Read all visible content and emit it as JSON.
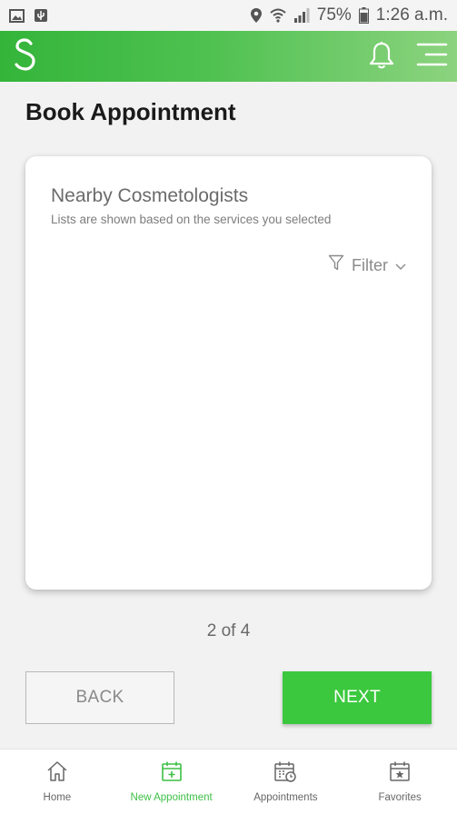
{
  "status_bar": {
    "battery": "75%",
    "time": "1:26 a.m."
  },
  "page": {
    "title": "Book Appointment"
  },
  "card": {
    "title": "Nearby Cosmetologists",
    "subtitle": "Lists are shown based on the services you selected",
    "filter_label": "Filter"
  },
  "step": {
    "text": "2 of 4"
  },
  "buttons": {
    "back": "BACK",
    "next": "NEXT"
  },
  "bottom_nav": {
    "items": [
      {
        "label": "Home",
        "icon": "home-icon"
      },
      {
        "label": "New Appointment",
        "icon": "calendar-plus-icon"
      },
      {
        "label": "Appointments",
        "icon": "calendar-clock-icon"
      },
      {
        "label": "Favorites",
        "icon": "calendar-star-icon"
      }
    ],
    "active_color": "#3dbf45"
  },
  "colors": {
    "brand_green": "#3bc83e",
    "app_bar_start": "#34b53a",
    "app_bar_end": "#8cd37f"
  }
}
